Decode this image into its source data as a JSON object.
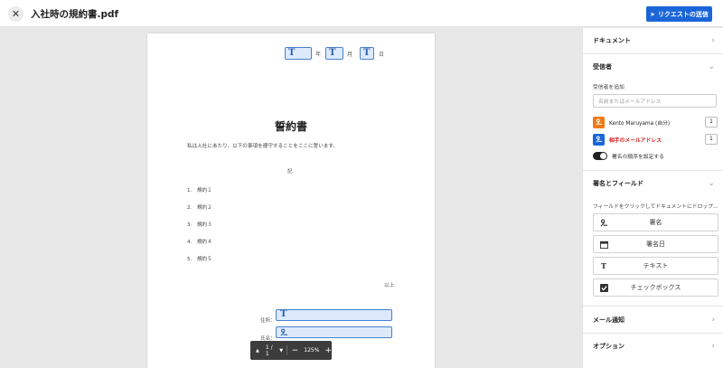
{
  "header": {
    "title": "入社時の規約書.pdf",
    "send_label": "リクエストの送信"
  },
  "document": {
    "date_units": [
      "年",
      "月",
      "日"
    ],
    "heading": "誓約書",
    "intro": "私は入社にあたり、以下の事項を遵守することをここに誓います。",
    "ki": "記",
    "clauses": [
      "1.　規約１",
      "2.　規約２",
      "3.　規約３",
      "4.　規約４",
      "5.　規約５"
    ],
    "ijo": "以上",
    "address_label": "住所：",
    "name_label": "氏名："
  },
  "pager": {
    "page": "1 / 1",
    "zoom": "125%"
  },
  "panel": {
    "document_label": "ドキュメント",
    "recipients_label": "受信者",
    "add_recipient_label": "受信者を追加",
    "recipient_placeholder": "名前またはメールアドレス",
    "recipients": [
      {
        "name": "Kento Maruyama (自分)",
        "order": "1",
        "color": "#f07a1a"
      },
      {
        "name": "相手のメールアドレス",
        "order": "1",
        "color": "#1a66d8"
      }
    ],
    "order_toggle_label": "署名の順序を設定する",
    "fields_label": "署名とフィールド",
    "fields_hint": "フィールドをクリックしてドキュメントにドロップ...",
    "field_buttons": [
      "署名",
      "署名日",
      "テキスト",
      "チェックボックス"
    ],
    "notify_label": "メール通知",
    "options_label": "オプション"
  }
}
